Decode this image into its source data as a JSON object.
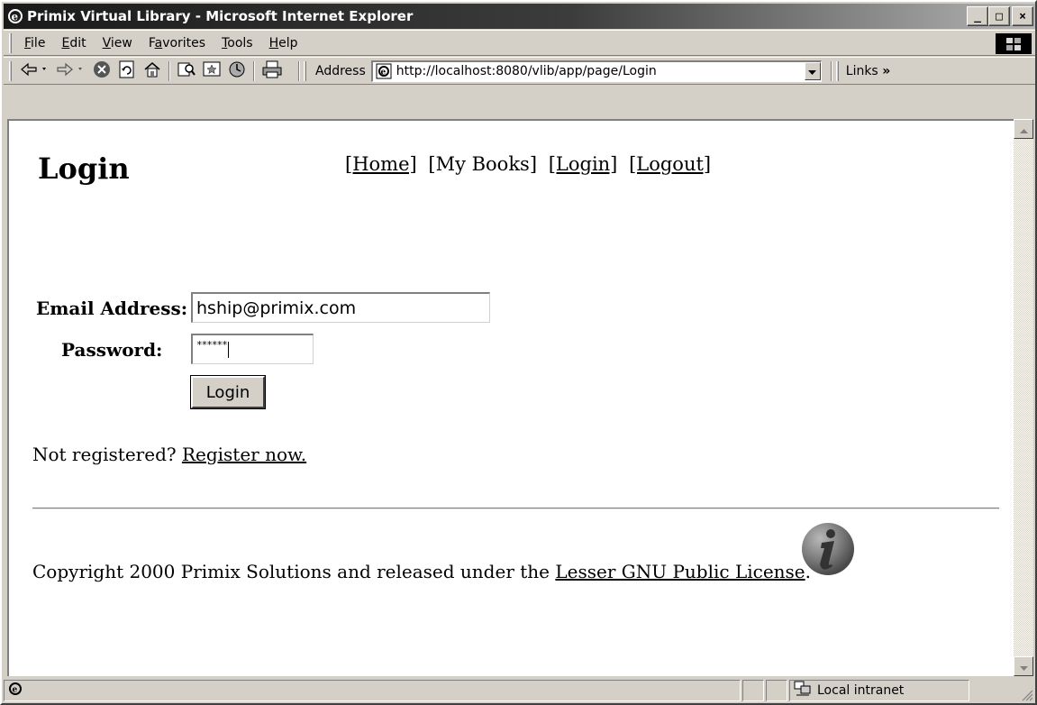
{
  "window": {
    "title": "Primix Virtual Library - Microsoft Internet Explorer",
    "controls": {
      "minimize": "_",
      "maximize": "□",
      "close": "×"
    }
  },
  "menubar": {
    "items": [
      {
        "label": "File",
        "accel": "F",
        "rest": "ile"
      },
      {
        "label": "Edit",
        "accel": "E",
        "rest": "dit"
      },
      {
        "label": "View",
        "accel": "V",
        "rest": "iew"
      },
      {
        "label": "Favorites",
        "pre": "F",
        "accel": "a",
        "rest": "vorites"
      },
      {
        "label": "Tools",
        "accel": "T",
        "rest": "ools"
      },
      {
        "label": "Help",
        "accel": "H",
        "rest": "elp"
      }
    ]
  },
  "toolbar": {
    "icons": [
      "back-icon",
      "forward-icon",
      "stop-icon",
      "refresh-icon",
      "home-icon",
      "search-icon",
      "favorites-icon",
      "history-icon",
      "print-icon"
    ],
    "address_label": "Address",
    "address_url": "http://localhost:8080/vlib/app/page/Login",
    "links_label": "Links"
  },
  "page": {
    "title": "Login",
    "nav": {
      "home": "[Home]",
      "my_books": "[My Books]",
      "login": "[Login]",
      "logout": "[Logout]"
    },
    "form": {
      "email_label": "Email Address:",
      "email_value": "hship@primix.com",
      "password_label": "Password:",
      "password_mask": "******",
      "login_button": "Login"
    },
    "not_registered": "Not registered?",
    "register_link": "Register now.",
    "copyright_text": "Copyright 2000 Primix Solutions and released under the",
    "license_link": "Lesser GNU Public License",
    "copyright_end": "."
  },
  "statusbar": {
    "zone": "Local intranet"
  }
}
